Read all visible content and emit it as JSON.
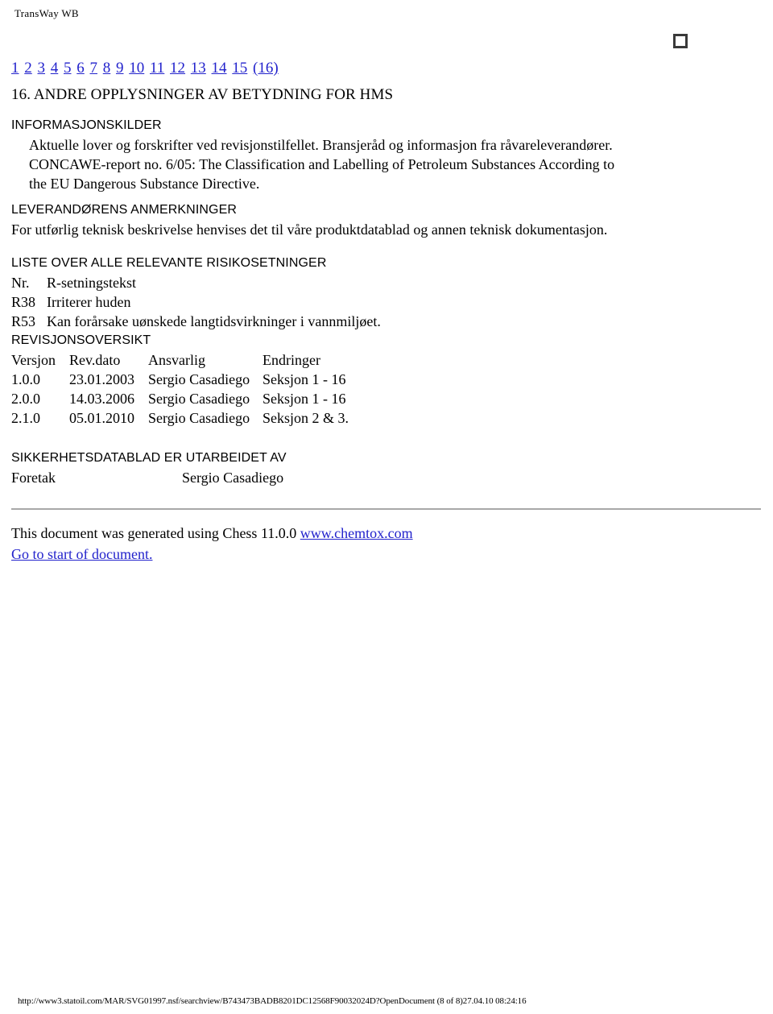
{
  "header": {
    "doc_title": "TransWay WB"
  },
  "pager": {
    "pages": [
      "1",
      "2",
      "3",
      "4",
      "5",
      "6",
      "7",
      "8",
      "9",
      "10",
      "11",
      "12",
      "13",
      "14",
      "15"
    ],
    "current": "(16)"
  },
  "section": {
    "number_and_title": "16. ANDRE OPPLYSNINGER AV BETYDNING FOR HMS",
    "marker_icon": "empty-checkbox-icon"
  },
  "info_sources": {
    "heading": "INFORMASJONSKILDER",
    "lines": [
      "Aktuelle lover og forskrifter ved revisjonstilfellet. Bransjeråd og informasjon fra råvareleverandører.",
      "CONCAWE-report no. 6/05: The Classification and Labelling of Petroleum Substances According to",
      "the EU Dangerous Substance Directive."
    ]
  },
  "supplier_notes": {
    "heading": "LEVERANDØRENS ANMERKNINGER",
    "text": "For utførlig teknisk beskrivelse henvises det til våre produktdatablad og annen teknisk dokumentasjon."
  },
  "risk_phrases": {
    "heading": "LISTE OVER ALLE RELEVANTE RISIKOSETNINGER",
    "columns": [
      "Nr.",
      "R-setningstekst"
    ],
    "rows": [
      {
        "code": "R38",
        "text": "Irriterer huden"
      },
      {
        "code": "R53",
        "text": "Kan forårsake uønskede langtidsvirkninger i vannmiljøet."
      }
    ]
  },
  "revision_history": {
    "heading": "REVISJONSOVERSIKT",
    "columns": [
      "Versjon",
      "Rev.dato",
      "Ansvarlig",
      "Endringer"
    ],
    "rows": [
      {
        "version": "1.0.0",
        "date": "23.01.2003",
        "responsible": "Sergio Casadiego",
        "changes": "Seksjon 1 - 16"
      },
      {
        "version": "2.0.0",
        "date": "14.03.2006",
        "responsible": "Sergio Casadiego",
        "changes": "Seksjon 1 - 16"
      },
      {
        "version": "2.1.0",
        "date": "05.01.2010",
        "responsible": "Sergio Casadiego",
        "changes": "Seksjon 2 & 3."
      }
    ]
  },
  "prepared_by": {
    "heading": "SIKKERHETSDATABLAD ER UTARBEIDET AV",
    "label": "Foretak",
    "value": "Sergio Casadiego"
  },
  "generated": {
    "text": "This document was generated using Chess 11.0.0 ",
    "link_text": "www.chemtox.com",
    "start_link": "Go to start of document."
  },
  "footer": {
    "url_and_stamp": "http://www3.statoil.com/MAR/SVG01997.nsf/searchview/B743473BADB8201DC12568F90032024D?OpenDocument (8 of 8)27.04.10 08:24:16"
  }
}
